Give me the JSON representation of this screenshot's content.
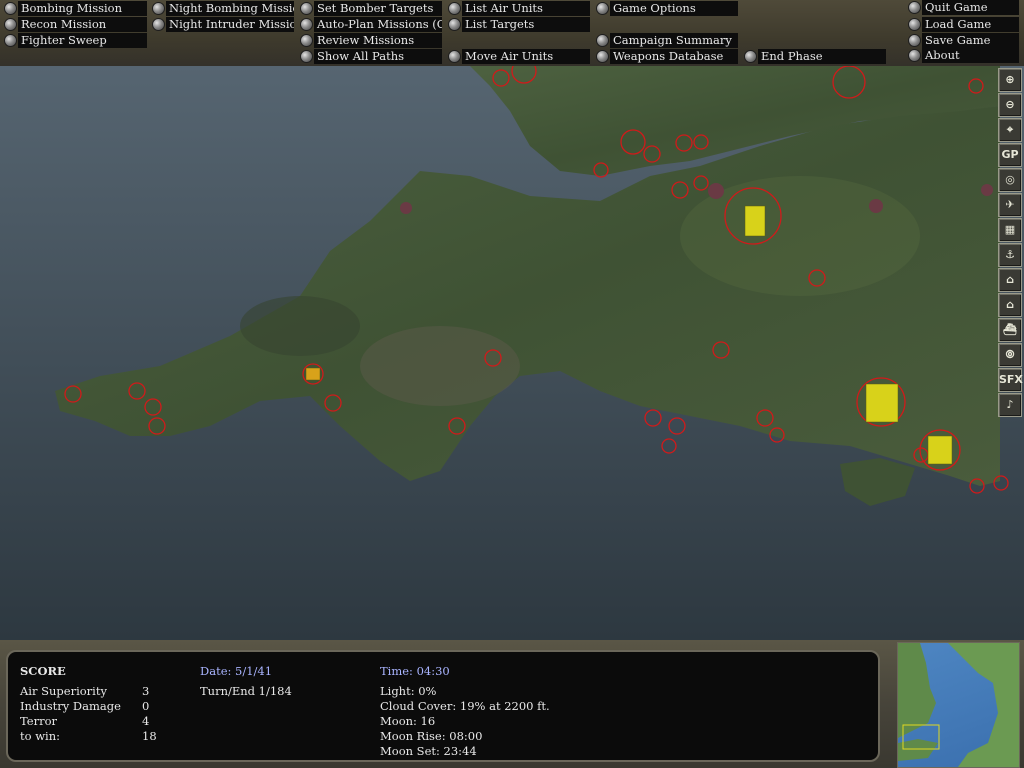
{
  "menu": {
    "col1": [
      "Bombing Mission",
      "Recon Mission",
      "Fighter Sweep"
    ],
    "col2": [
      "Night Bombing Mission",
      "Night Intruder Mission"
    ],
    "col3": [
      "Set Bomber Targets",
      "Auto-Plan Missions (Off)",
      "Review Missions",
      "Show All Paths"
    ],
    "col4": [
      "List Air Units",
      "List Targets",
      "Move Air Units"
    ],
    "col5": [
      "Game Options",
      "Campaign Summary",
      "Weapons Database"
    ],
    "col6": [
      "End Phase"
    ],
    "col7": [
      "Quit Game",
      "Load Game",
      "Save Game",
      "About"
    ]
  },
  "toolbar": {
    "gp_label": "GP",
    "sfx_label": "SFX"
  },
  "score": {
    "title": "SCORE",
    "rows": [
      {
        "label": "Air Superiority",
        "value": "3"
      },
      {
        "label": "Industry Damage",
        "value": "0"
      },
      {
        "label": "Terror",
        "value": "4"
      },
      {
        "label": "to win:",
        "value": "18"
      }
    ]
  },
  "status": {
    "date": "Date: 5/1/41",
    "turn": "Turn/End 1/184",
    "time": "Time: 04:30",
    "light": "Light: 0%",
    "cloud": "Cloud Cover: 19% at 2200 ft.",
    "moon": "Moon: 16",
    "moonrise": "Moon Rise: 08:00",
    "moonset": "Moon Set: 23:44"
  },
  "colors": {
    "target_ring": "#d11a1a",
    "city": "#d8d21a",
    "info_header": "#a9b4ff"
  }
}
